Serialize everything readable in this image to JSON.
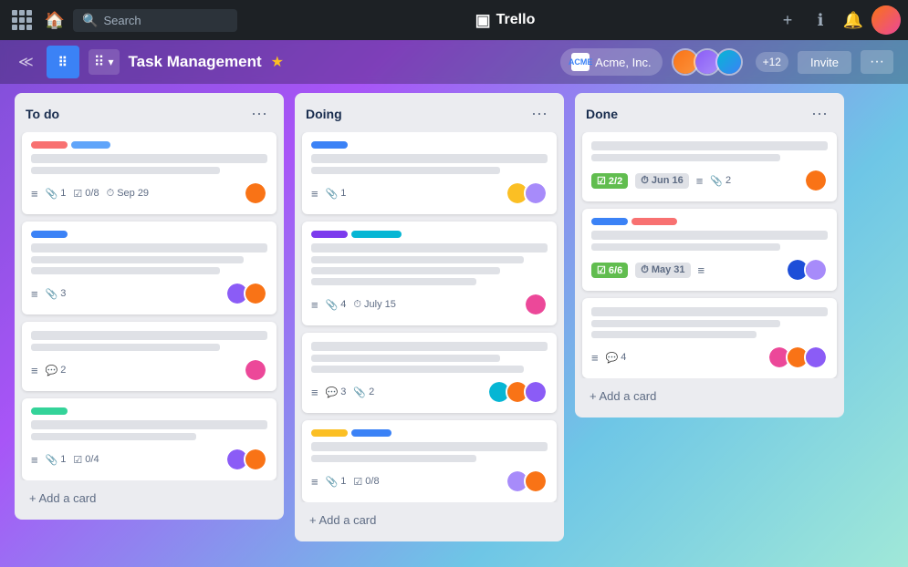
{
  "app": {
    "title": "Trello",
    "nav": {
      "search_placeholder": "Search",
      "add_label": "+",
      "info_label": "ⓘ",
      "bell_label": "🔔"
    }
  },
  "board": {
    "org_name": "Acme, Inc.",
    "title": "Task Management",
    "plus_members": "+12",
    "invite_label": "Invite",
    "more_label": "···",
    "collapse_label": "≪"
  },
  "columns": [
    {
      "id": "todo",
      "title": "To do",
      "cards": [
        {
          "id": "c1",
          "labels": [
            {
              "color": "#f87171"
            },
            {
              "color": "#60a5fa"
            }
          ],
          "lines": [
            100,
            80
          ],
          "meta": [
            {
              "icon": "≡",
              "text": ""
            },
            {
              "icon": "📎",
              "text": "1"
            },
            {
              "icon": "☑",
              "text": "0/8"
            },
            {
              "icon": "⏱",
              "text": "Sep 29"
            }
          ],
          "avatars": [
            {
              "color": "#f97316"
            }
          ]
        },
        {
          "id": "c2",
          "labels": [
            {
              "color": "#3b82f6"
            }
          ],
          "lines": [
            100,
            90,
            80
          ],
          "meta": [
            {
              "icon": "≡",
              "text": ""
            },
            {
              "icon": "📎",
              "text": "3"
            }
          ],
          "avatars": [
            {
              "color": "#8b5cf6"
            },
            {
              "color": "#f97316"
            }
          ]
        },
        {
          "id": "c3",
          "labels": [],
          "lines": [
            100,
            80
          ],
          "meta": [
            {
              "icon": "≡",
              "text": ""
            },
            {
              "icon": "💬",
              "text": "2"
            }
          ],
          "avatars": [
            {
              "color": "#ec4899"
            }
          ]
        },
        {
          "id": "c4",
          "labels": [
            {
              "color": "#34d399"
            }
          ],
          "lines": [
            100,
            70
          ],
          "meta": [
            {
              "icon": "≡",
              "text": ""
            },
            {
              "icon": "📎",
              "text": "1"
            },
            {
              "icon": "☑",
              "text": "0/4"
            }
          ],
          "avatars": [
            {
              "color": "#8b5cf6"
            },
            {
              "color": "#f97316"
            }
          ]
        }
      ],
      "add_card_label": "+ Add a card"
    },
    {
      "id": "doing",
      "title": "Doing",
      "cards": [
        {
          "id": "d1",
          "labels": [
            {
              "color": "#3b82f6"
            }
          ],
          "lines": [
            100,
            80
          ],
          "meta": [
            {
              "icon": "≡",
              "text": ""
            },
            {
              "icon": "📎",
              "text": "1"
            }
          ],
          "avatars": [
            {
              "color": "#fbbf24"
            },
            {
              "color": "#a78bfa"
            }
          ]
        },
        {
          "id": "d2",
          "labels": [
            {
              "color": "#7c3aed"
            },
            {
              "color": "#06b6d4"
            }
          ],
          "lines": [
            100,
            90,
            80,
            70
          ],
          "meta": [
            {
              "icon": "≡",
              "text": ""
            },
            {
              "icon": "📎",
              "text": "4"
            },
            {
              "icon": "⏱",
              "text": "July 15"
            }
          ],
          "avatars": [
            {
              "color": "#ec4899"
            }
          ]
        },
        {
          "id": "d3",
          "labels": [],
          "lines": [
            100,
            80,
            90
          ],
          "meta": [
            {
              "icon": "≡",
              "text": ""
            },
            {
              "icon": "💬",
              "text": "3"
            },
            {
              "icon": "📎",
              "text": "2"
            }
          ],
          "avatars": [
            {
              "color": "#06b6d4"
            },
            {
              "color": "#f97316"
            },
            {
              "color": "#8b5cf6"
            }
          ]
        },
        {
          "id": "d4",
          "labels": [
            {
              "color": "#fbbf24"
            },
            {
              "color": "#3b82f6"
            }
          ],
          "lines": [
            100,
            70
          ],
          "meta": [
            {
              "icon": "≡",
              "text": ""
            },
            {
              "icon": "📎",
              "text": "1"
            },
            {
              "icon": "☑",
              "text": "0/8"
            }
          ],
          "avatars": [
            {
              "color": "#a78bfa"
            },
            {
              "color": "#f97316"
            }
          ]
        }
      ],
      "add_card_label": "+ Add a card"
    },
    {
      "id": "done",
      "title": "Done",
      "cards": [
        {
          "id": "dn1",
          "labels": [],
          "lines": [
            100,
            80
          ],
          "meta": [
            {
              "icon": "≡",
              "text": ""
            },
            {
              "icon": "📎",
              "text": "2"
            }
          ],
          "badges": [
            {
              "type": "green",
              "text": "2/2"
            },
            {
              "type": "clock",
              "text": "Jun 16"
            }
          ],
          "avatars": [
            {
              "color": "#f97316"
            }
          ]
        },
        {
          "id": "dn2",
          "labels": [
            {
              "color": "#3b82f6"
            },
            {
              "color": "#f87171"
            }
          ],
          "lines": [
            100,
            80
          ],
          "meta": [
            {
              "icon": "≡",
              "text": ""
            }
          ],
          "badges": [
            {
              "type": "green",
              "text": "6/6"
            },
            {
              "type": "clock",
              "text": "May 31"
            }
          ],
          "avatars": [
            {
              "color": "#1d4ed8"
            },
            {
              "color": "#a78bfa"
            }
          ]
        },
        {
          "id": "dn3",
          "labels": [],
          "lines": [
            100,
            80,
            70
          ],
          "meta": [
            {
              "icon": "≡",
              "text": ""
            },
            {
              "icon": "💬",
              "text": "4"
            }
          ],
          "avatars": [
            {
              "color": "#ec4899"
            },
            {
              "color": "#f97316"
            },
            {
              "color": "#8b5cf6"
            }
          ]
        }
      ],
      "add_card_label": "+ Add a card"
    }
  ]
}
